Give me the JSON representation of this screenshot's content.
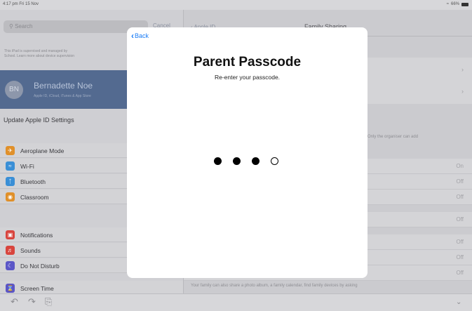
{
  "status": {
    "time": "4:17 pm  Fri 15 Nov",
    "battery": "66%"
  },
  "sidebar": {
    "search_placeholder": "Search",
    "cancel": "Cancel",
    "supervised_line1": "This iPad is supervised and managed by",
    "supervised_line2": "School. Learn more about device supervision",
    "profile": {
      "initials": "BN",
      "name": "Bernadette Noe",
      "subtitle": "Apple ID, iCloud, iTunes & App Store"
    },
    "update": "Update Apple ID Settings",
    "items": [
      {
        "label": "Aeroplane Mode",
        "icon": "airplane-icon",
        "color": "#e0902a"
      },
      {
        "label": "Wi-Fi",
        "icon": "wifi-icon",
        "color": "#3a8fd6"
      },
      {
        "label": "Bluetooth",
        "icon": "bluetooth-icon",
        "color": "#3a8fd6"
      },
      {
        "label": "Classroom",
        "icon": "classroom-icon",
        "color": "#e0902a"
      },
      {
        "label": "Notifications",
        "icon": "notifications-icon",
        "color": "#d8453e"
      },
      {
        "label": "Sounds",
        "icon": "sounds-icon",
        "color": "#d8453e"
      },
      {
        "label": "Do Not Disturb",
        "icon": "moon-icon",
        "color": "#5b56c7"
      },
      {
        "label": "Screen Time",
        "icon": "hourglass-icon",
        "color": "#5b56c7"
      }
    ]
  },
  "detail": {
    "back": "Apple ID",
    "title": "Family Sharing",
    "note": "Only the organiser can add",
    "rows": [
      "On",
      "Off",
      "Off",
      "Off",
      "Off",
      "Off",
      "Off"
    ],
    "footer": "Your family can also share a photo album, a family calendar, find family devices by asking"
  },
  "modal": {
    "back_label": "Back",
    "title": "Parent Passcode",
    "subtitle": "Re-enter your passcode.",
    "digits_entered": 3,
    "digits_total": 4
  }
}
